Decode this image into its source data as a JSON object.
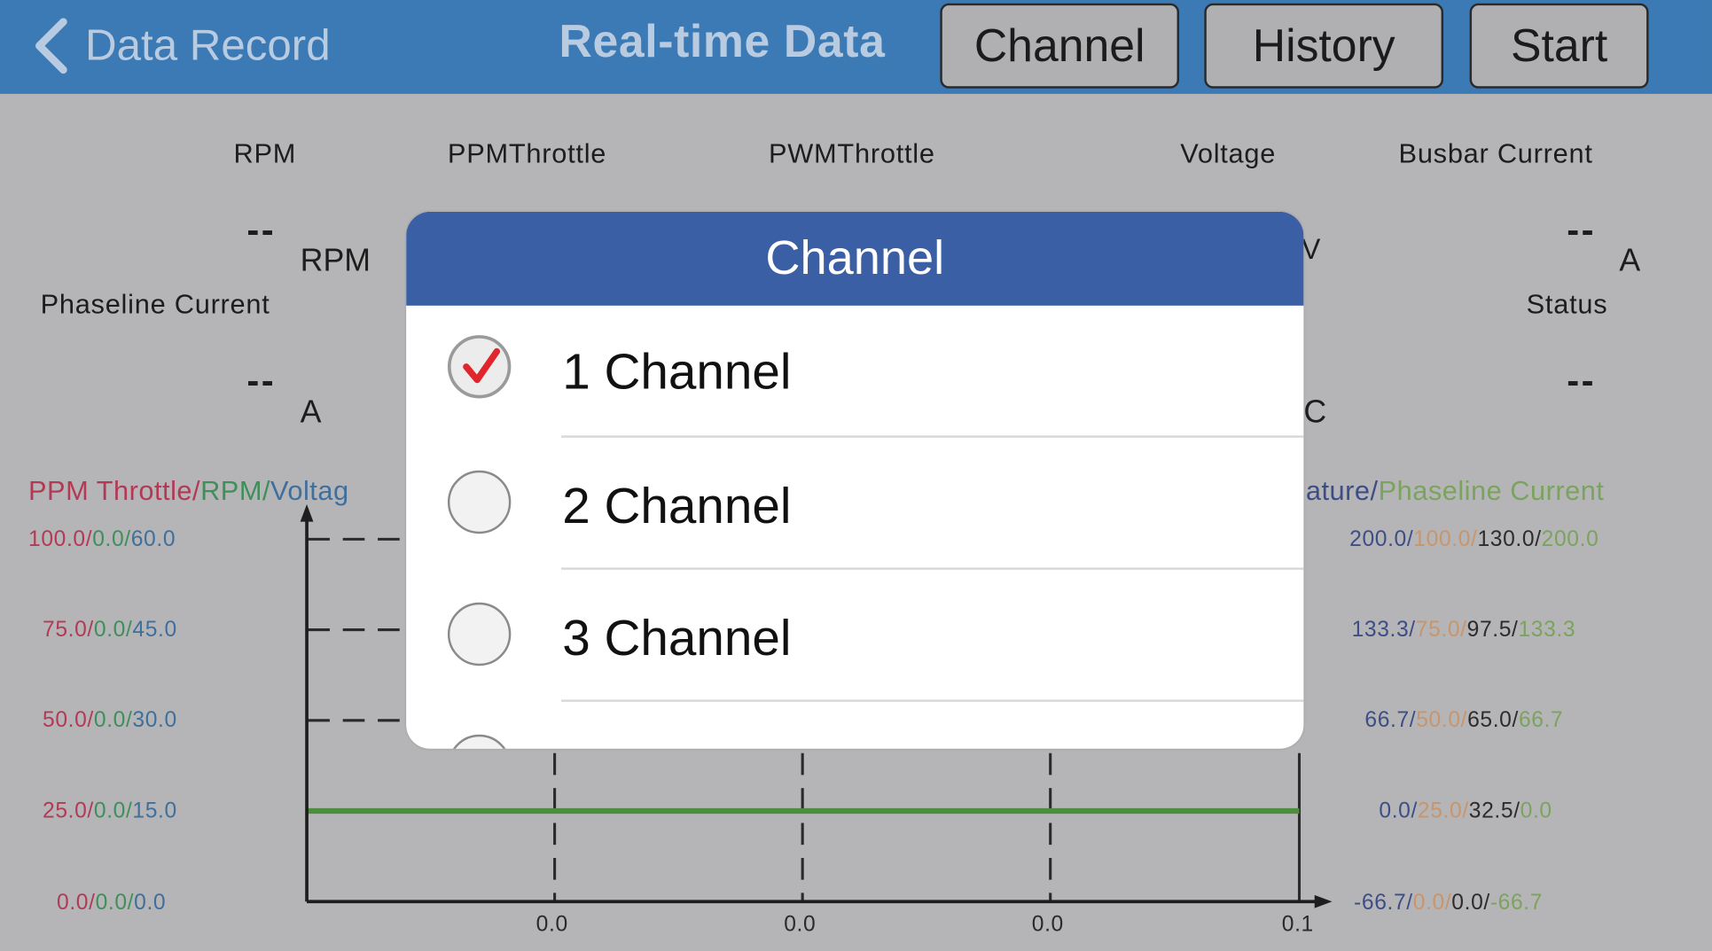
{
  "nav": {
    "back_label": "Data Record",
    "title": "Real-time Data",
    "buttons": [
      "Channel",
      "History",
      "Start"
    ]
  },
  "info": {
    "headers_row1": [
      "RPM",
      "PPMThrottle",
      "PWMThrottle",
      "Voltage",
      "Busbar Current"
    ],
    "headers_row2": [
      "Phaseline Current",
      "Status"
    ],
    "values": {
      "rpm": "--",
      "busbar": "--",
      "phaseline": "--",
      "status": "--"
    },
    "units": {
      "rpm": "RPM",
      "busbar": "A",
      "phaseline": "A",
      "partial_v": "V",
      "partial_c": "C"
    }
  },
  "chart": {
    "left_title": {
      "ppm": "PPM Throttle/",
      "rpm": "RPM/",
      "volt": "Voltag"
    },
    "right_title": {
      "temp": "ature/",
      "phase": "Phaseline Current"
    },
    "left_ticks": [
      [
        "100.0/",
        "0.0/",
        "60.0"
      ],
      [
        "75.0/",
        "0.0/",
        "45.0"
      ],
      [
        "50.0/",
        "0.0/",
        "30.0"
      ],
      [
        "25.0/",
        "0.0/",
        "15.0"
      ],
      [
        "0.0/",
        "0.0/",
        "0.0"
      ]
    ],
    "right_ticks": [
      [
        "200.0/",
        "100.0/",
        "130.0/",
        "200.0"
      ],
      [
        "133.3/",
        "75.0/",
        "97.5/",
        "133.3"
      ],
      [
        "66.7/",
        "50.0/",
        "65.0/",
        "66.7"
      ],
      [
        "0.0/",
        "25.0/",
        "32.5/",
        "0.0"
      ],
      [
        "-66.7/",
        "0.0/",
        "0.0/",
        "-66.7"
      ]
    ],
    "x_ticks": [
      "0.0",
      "0.0",
      "0.0",
      "0.1"
    ],
    "colors": {
      "ppm": "#b23a56",
      "rpm": "#3f8f5a",
      "volt": "#3f6f9c",
      "right1": "#3d4e86",
      "right2": "#c9956a",
      "right3": "#2c2c2c",
      "right4": "#7aa45e",
      "flat_line": "#4d8e3e"
    }
  },
  "modal": {
    "title": "Channel",
    "options": [
      {
        "label": "1 Channel",
        "checked": true
      },
      {
        "label": "2 Channel",
        "checked": false
      },
      {
        "label": "3 Channel",
        "checked": false
      }
    ]
  }
}
